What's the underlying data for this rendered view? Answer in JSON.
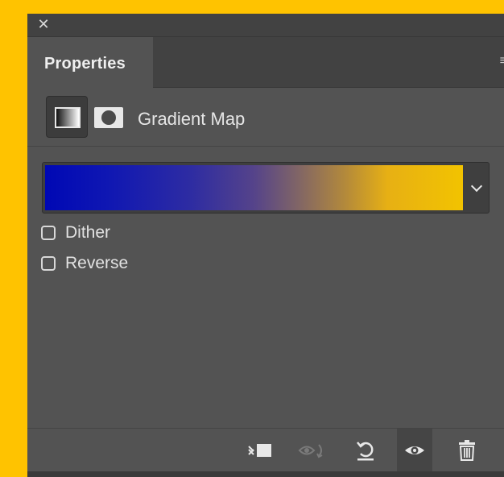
{
  "panel": {
    "close_glyph": "✕",
    "tab_label": "Properties",
    "menu_glyph": "≡"
  },
  "adjustment": {
    "title": "Gradient Map",
    "icons": [
      "gradient-map-adjustment-icon",
      "layer-mask-icon"
    ]
  },
  "gradient": {
    "colors": [
      "#0008B4",
      "#2E2CA2",
      "#7E6368",
      "#E7B014",
      "#F2C300"
    ]
  },
  "options": {
    "dither_label": "Dither",
    "dither_checked": false,
    "reverse_label": "Reverse",
    "reverse_checked": false
  },
  "toolbar": {
    "buttons": [
      "clip-to-layer-icon",
      "view-previous-state-icon",
      "reset-icon",
      "toggle-visibility-icon",
      "delete-icon"
    ]
  },
  "colors": {
    "background": "#FFC300",
    "panel": "#535353",
    "panel_dark": "#424242"
  }
}
